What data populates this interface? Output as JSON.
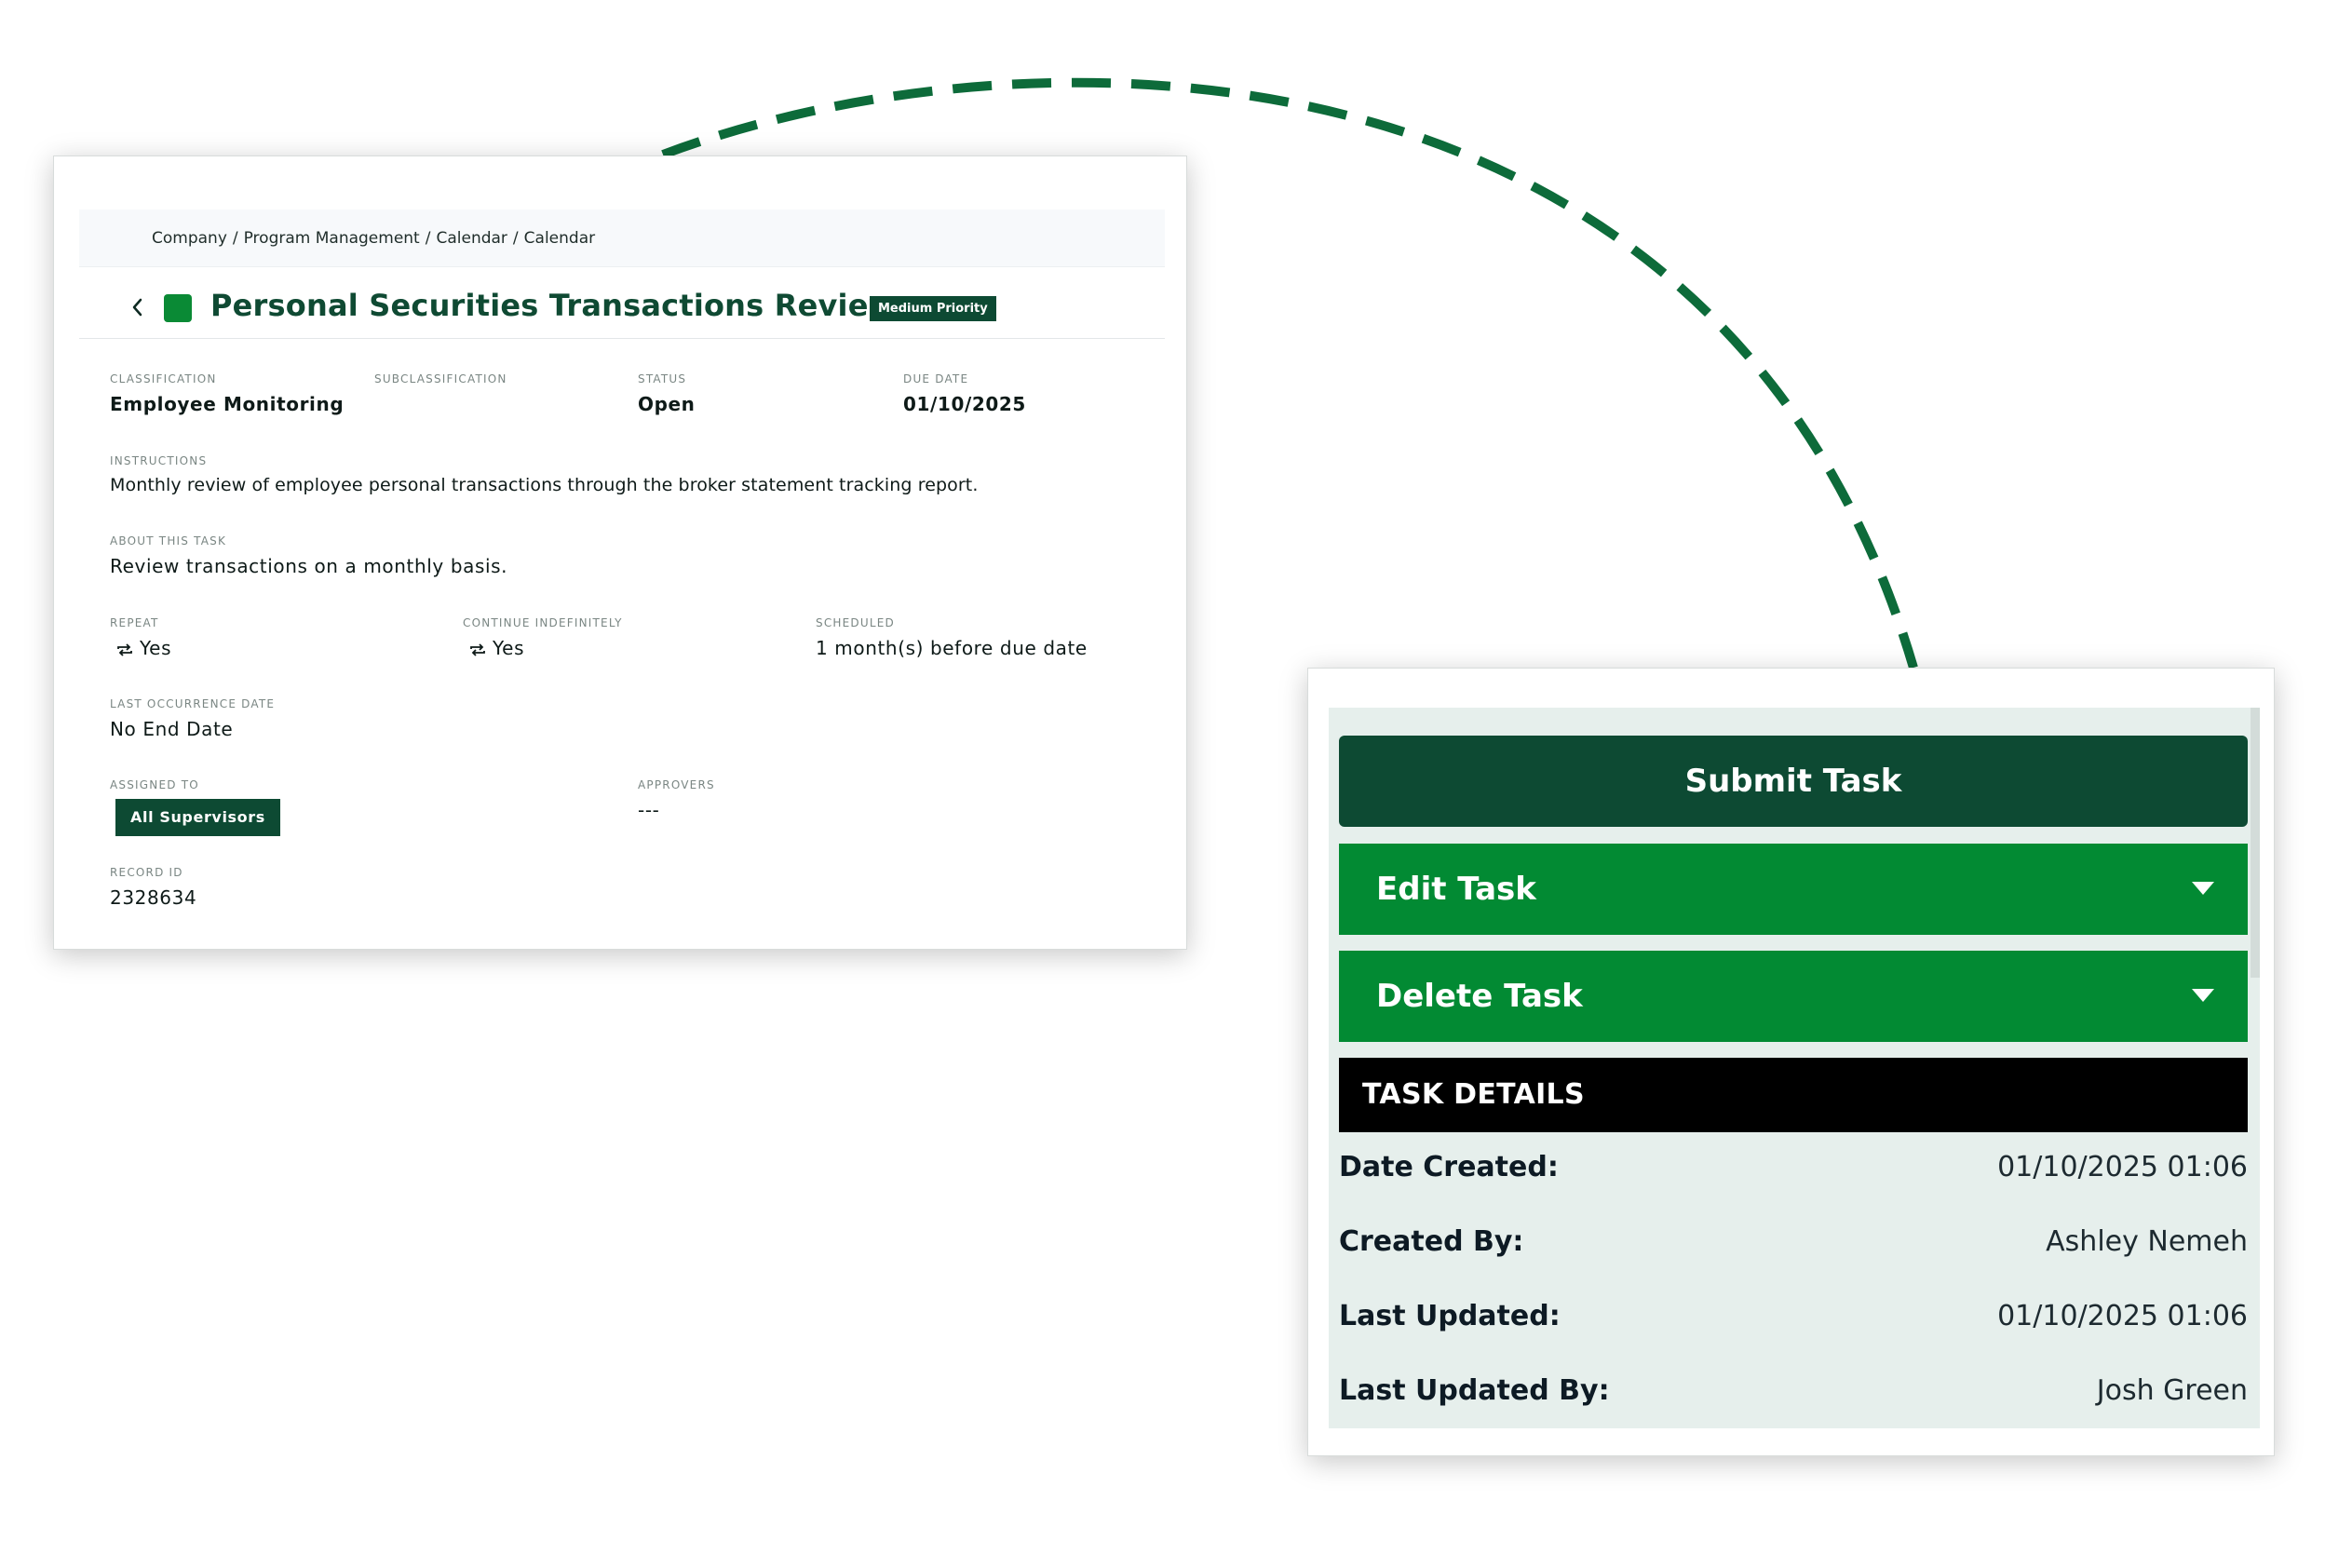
{
  "breadcrumb": [
    "Company",
    "Program Management",
    "Calendar",
    "Calendar"
  ],
  "task": {
    "title": "Personal Securities Transactions Review",
    "priority": "Medium Priority",
    "classification_label": "CLASSIFICATION",
    "classification": "Employee Monitoring",
    "subclassification_label": "SUBCLASSIFICATION",
    "status_label": "STATUS",
    "status": "Open",
    "due_date_label": "DUE DATE",
    "due_date": "01/10/2025",
    "instructions_label": "INSTRUCTIONS",
    "instructions": "Monthly review of employee personal transactions through the broker statement tracking report.",
    "about_label": "ABOUT THIS TASK",
    "about": "Review transactions on a monthly basis.",
    "repeat_label": "REPEAT",
    "repeat": "Yes",
    "continue_label": "CONTINUE INDEFINITELY",
    "continue": "Yes",
    "scheduled_label": "SCHEDULED",
    "scheduled": "1 month(s) before due date",
    "last_occurrence_label": "LAST OCCURRENCE DATE",
    "last_occurrence": "No End Date",
    "assigned_label": "ASSIGNED TO",
    "assigned": "All Supervisors",
    "approvers_label": "APPROVERS",
    "approvers": "---",
    "record_id_label": "RECORD ID",
    "record_id": "2328634"
  },
  "actions": {
    "submit": "Submit Task",
    "edit": "Edit Task",
    "delete": "Delete Task"
  },
  "details": {
    "header": "TASK DETAILS",
    "rows": [
      {
        "key": "Date Created:",
        "value": "01/10/2025 01:06"
      },
      {
        "key": "Created By:",
        "value": "Ashley Nemeh"
      },
      {
        "key": "Last Updated:",
        "value": "01/10/2025 01:06"
      },
      {
        "key": "Last Updated By:",
        "value": "Josh Green"
      }
    ]
  },
  "colors": {
    "dark_green": "#0d4a33",
    "bright_green": "#028a33",
    "panel_bg": "#e6efec",
    "arc": "#0d6b3a"
  },
  "icons": [
    "chevron-left-icon",
    "green-square-icon",
    "repeat-icon",
    "caret-down-icon"
  ]
}
